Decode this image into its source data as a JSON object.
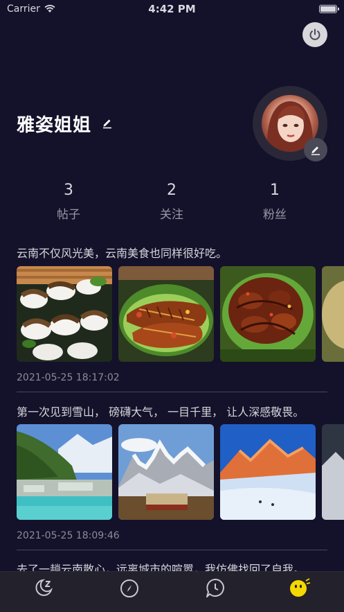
{
  "status_bar": {
    "carrier": "Carrier",
    "time": "4:42 PM"
  },
  "profile": {
    "name": "雅姿姐姐"
  },
  "stats": [
    {
      "value": "3",
      "label": "帖子"
    },
    {
      "value": "2",
      "label": "关注"
    },
    {
      "value": "1",
      "label": "粉丝"
    }
  ],
  "posts": [
    {
      "text": "云南不仅风光美，云南美食也同样很好吃。",
      "date": "2021-05-25 18:17:02",
      "photos": [
        "sushi-photo",
        "grilled-fish-photo",
        "roast-meat-photo"
      ]
    },
    {
      "text": "第一次见到雪山， 磅礴大气， 一目千里， 让人深感敬畏。",
      "date": "2021-05-25 18:09:46",
      "photos": [
        "blue-moon-valley-photo",
        "snow-mountain-photo",
        "sunset-snow-peak-photo"
      ]
    },
    {
      "text": "去了一趟云南散心，远离城市的喧嚣，我仿佛找回了自我。"
    }
  ],
  "tabbar": {
    "items": [
      "moon-sleep-icon",
      "compass-icon",
      "chat-bubble-icon",
      "smiley-face-icon"
    ],
    "active_color": "#f5d800",
    "inactive_color": "#c9c9d2"
  },
  "colors": {
    "background": "#14112a",
    "accent": "#f5d800"
  }
}
